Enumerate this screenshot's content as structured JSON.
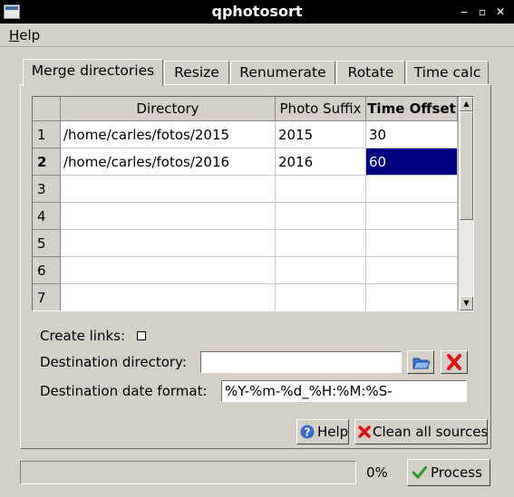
{
  "window": {
    "title": "qphotosort",
    "buttons": [
      "‒",
      "▫",
      "✕"
    ]
  },
  "menu": {
    "items": [
      {
        "label": "Help",
        "mnemonic": "H",
        "rest": "elp"
      }
    ]
  },
  "tabs": [
    {
      "label": "Merge directories",
      "active": true
    },
    {
      "label": "Resize",
      "active": false
    },
    {
      "label": "Renumerate",
      "active": false
    },
    {
      "label": "Rotate",
      "active": false
    },
    {
      "label": "Time calc",
      "active": false
    }
  ],
  "table": {
    "columns": [
      "Directory",
      "Photo Suffix",
      "Time Offset"
    ],
    "rows": [
      {
        "num": "1",
        "directory": "/home/carles/fotos/2015",
        "suffix": "2015",
        "offset": "30"
      },
      {
        "num": "2",
        "directory": "/home/carles/fotos/2016",
        "suffix": "2016",
        "offset": "60"
      },
      {
        "num": "3",
        "directory": "",
        "suffix": "",
        "offset": ""
      },
      {
        "num": "4",
        "directory": "",
        "suffix": "",
        "offset": ""
      },
      {
        "num": "5",
        "directory": "",
        "suffix": "",
        "offset": ""
      },
      {
        "num": "6",
        "directory": "",
        "suffix": "",
        "offset": ""
      },
      {
        "num": "7",
        "directory": "",
        "suffix": "",
        "offset": ""
      }
    ],
    "selected_row": 2,
    "selected_column": "Time Offset"
  },
  "form": {
    "create_links_label": "Create links:",
    "create_links_checked": false,
    "dest_dir_label": "Destination directory:",
    "dest_dir_value": "",
    "dest_format_label": "Destination date format:",
    "dest_format_value": "%Y-%m-%d_%H:%M:%S-"
  },
  "buttons": {
    "help": "Help",
    "clean": "Clean all sources",
    "process": "Process",
    "browse_icon": "folder-open-icon",
    "clear_icon": "red-x-icon"
  },
  "progress": {
    "value": 0,
    "label": "0%"
  },
  "colors": {
    "selection": "#000080",
    "red": "#e01010",
    "green": "#2a9a2a",
    "help_blue": "#3a6ac8"
  }
}
